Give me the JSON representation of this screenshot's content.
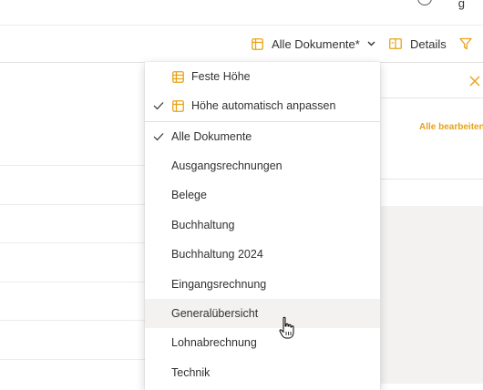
{
  "topbar": {
    "label": "g"
  },
  "commandbar": {
    "view_selector": "Alle Dokumente*",
    "details": "Details"
  },
  "panel": {
    "edit_all": "Alle bearbeiten"
  },
  "menu": {
    "height_options": [
      {
        "label": "Feste Höhe",
        "checked": false
      },
      {
        "label": "Höhe automatisch anpassen",
        "checked": true
      }
    ],
    "views": [
      {
        "label": "Alle Dokumente",
        "checked": true
      },
      {
        "label": "Ausgangsrechnungen",
        "checked": false
      },
      {
        "label": "Belege",
        "checked": false
      },
      {
        "label": "Buchhaltung",
        "checked": false
      },
      {
        "label": "Buchhaltung 2024",
        "checked": false
      },
      {
        "label": "Eingangsrechnung",
        "checked": false
      },
      {
        "label": "Generalübersicht",
        "checked": false,
        "hovered": true
      },
      {
        "label": "Lohnabrechnung",
        "checked": false
      },
      {
        "label": "Technik",
        "checked": false
      }
    ]
  },
  "colors": {
    "accent": "#e8a317",
    "text": "#323130",
    "hover": "#f3f2f1"
  }
}
